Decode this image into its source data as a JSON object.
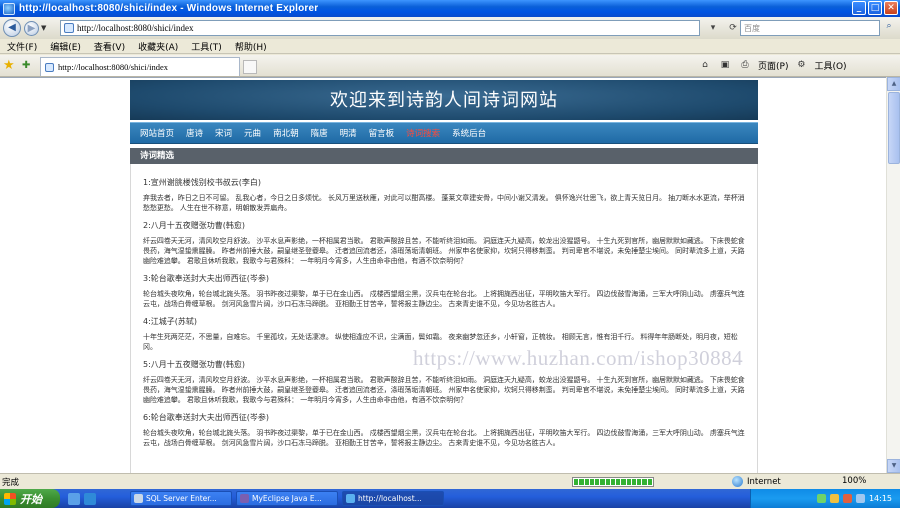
{
  "window": {
    "title": "http://localhost:8080/shici/index - Windows Internet Explorer",
    "minimize": "_",
    "maximize": "□",
    "close": "✕"
  },
  "address_bar": {
    "url": "http://localhost:8080/shici/index",
    "search_placeholder": "百度"
  },
  "menu": [
    "文件(F)",
    "编辑(E)",
    "查看(V)",
    "收藏夹(A)",
    "工具(T)",
    "帮助(H)"
  ],
  "tab": {
    "label": "http://localhost:8080/shici/index"
  },
  "command_bar": {
    "page_label": "页面(P)",
    "tools_label": "工具(O)"
  },
  "site": {
    "banner_title": "欢迎来到诗韵人间诗词网站",
    "nav": [
      "网站首页",
      "唐诗",
      "宋词",
      "元曲",
      "南北朝",
      "隋唐",
      "明清",
      "留言板",
      "诗词搜索",
      "系统后台"
    ],
    "active_nav_index": 8,
    "section_title": "诗词精选",
    "poems": [
      {
        "title": "1:宣州谢朓楼饯别校书叔云(李白)",
        "text": "弃我去者，昨日之日不可留。 乱我心者，今日之日多烦忧。 长风万里送秋雁，对此可以酣高楼。 蓬莱文章建安骨，中间小谢又清发。 俱怀逸兴壮思飞，欲上青天览日月。 抽刀断水水更流，举杯消愁愁更愁。 人生在世不称意，明朝散发弄扁舟。"
      },
      {
        "title": "2:八月十五夜赠张功曹(韩愈)",
        "text": "纤云四卷天无河，清风吹空月舒波。 沙平水息声影绝，一杯相属君当歌。 君歌声酸辞且苦，不能听终泪如雨。 洞庭连天九疑高，蛟龙出没猩鼯号。 十生九死到官所，幽居默默如藏逃。 下床畏蛇食畏药，海气湿蛰熏腥臊。 昨者州前捶大鼓，嗣皇继圣登夔皋。 迁者追回流者还，涤瑕荡垢清朝班。 州家申名使家抑，坎轲只得移荆蛮。 判司卑官不堪说，未免捶楚尘埃间。 同时辈流多上道，天路幽险难追攀。 君歌且休听我歌，我歌今与君殊科： 一年明月今宵多，人生由命非由他，有酒不饮奈明何？"
      },
      {
        "title": "3:轮台歌奉送封大夫出师西征(岑参)",
        "text": "轮台城头夜吹角，轮台城北旄头落。 羽书昨夜过渠黎，单于已在金山西。 戍楼西望烟尘黑，汉兵屯在轮台北。 上将拥旄西出征，平明吹笛大军行。 四边伐鼓雪海涌，三军大呼阴山动。 虏塞兵气连云屯，战场白骨缠草根。 剑河风急雪片阔，沙口石冻马蹄脱。 亚相勤王甘苦辛，誓将报主静边尘。 古来青史谁不见，今见功名胜古人。"
      },
      {
        "title": "4:江城子(苏轼)",
        "text": "十年生死两茫茫，不思量，自难忘。 千里孤坟，无处话凄凉。 纵使相逢应不识，尘满面，鬓如霜。 夜来幽梦忽还乡，小轩窗，正梳妆。 相顾无言，惟有泪千行。 料得年年肠断处，明月夜，短松冈。"
      },
      {
        "title": "5:八月十五夜赠张功曹(韩愈)",
        "text": "纤云四卷天无河，清风吹空月舒波。 沙平水息声影绝，一杯相属君当歌。 君歌声酸辞且苦，不能听终泪如雨。 洞庭连天九疑高，蛟龙出没猩鼯号。 十生九死到官所，幽居默默如藏逃。 下床畏蛇食畏药，海气湿蛰熏腥臊。 昨者州前捶大鼓，嗣皇继圣登夔皋。 迁者追回流者还，涤瑕荡垢清朝班。 州家申名使家抑，坎轲只得移荆蛮。 判司卑官不堪说，未免捶楚尘埃间。 同时辈流多上道，天路幽险难追攀。 君歌且休听我歌，我歌今与君殊科： 一年明月今宵多，人生由命非由他，有酒不饮奈明何？"
      },
      {
        "title": "6:轮台歌奉送封大夫出师西征(岑参)",
        "text": "轮台城头夜吹角，轮台城北旄头落。 羽书昨夜过渠黎，单于已在金山西。 戍楼西望烟尘黑，汉兵屯在轮台北。 上将拥旄西出征，平明吹笛大军行。 四边伐鼓雪海涌，三军大呼阴山动。 虏塞兵气连云屯，战场白骨缠草根。 剑河风急雪片阔，沙口石冻马蹄脱。 亚相勤王甘苦辛，誓将报主静边尘。 古来青史谁不见，今见功名胜古人。"
      }
    ],
    "watermark": "https://www.huzhan.com/ishop30884"
  },
  "status_bar": {
    "status": "完成",
    "zone": "Internet",
    "zoom": "100%",
    "progress_fraction": 1.0
  },
  "taskbar": {
    "start": "开始",
    "tasks": [
      "SQL Server Enter...",
      "MyEclipse Java E...",
      "http://localhost..."
    ],
    "active_task_index": 2,
    "clock": "14:15"
  },
  "colors": {
    "banner": "#1e4a6d",
    "nav_bar": "#1f6aa5",
    "nav_active": "#ff4a3a",
    "section_head": "#59616a",
    "taskbar": "#245edb"
  }
}
